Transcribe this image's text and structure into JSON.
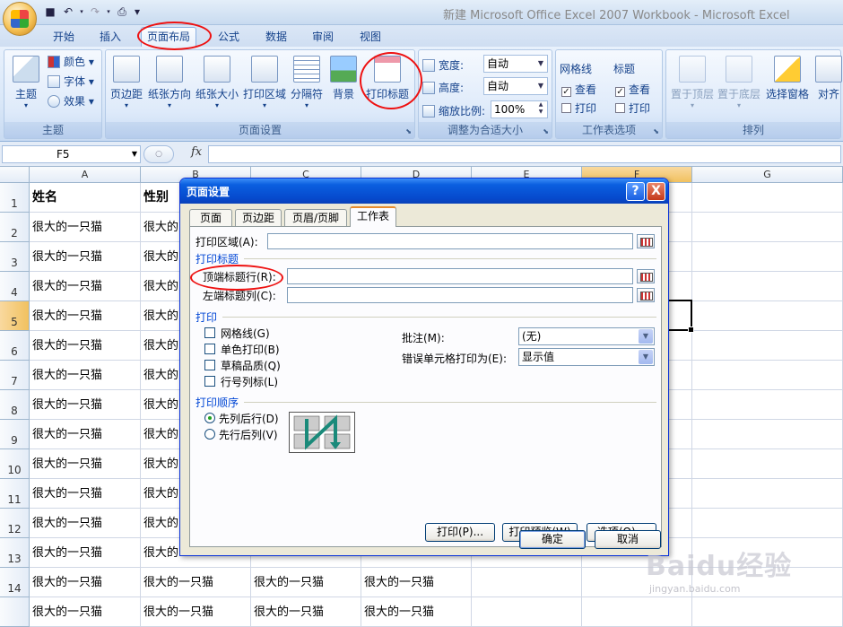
{
  "window": {
    "title": "新建 Microsoft Office Excel 2007 Workbook - Microsoft Excel"
  },
  "tabs": [
    "开始",
    "插入",
    "页面布局",
    "公式",
    "数据",
    "审阅",
    "视图"
  ],
  "active_tab": "页面布局",
  "ribbon": {
    "themes_group": {
      "title": "主题",
      "themes_button": "主题",
      "colors": "颜色",
      "fonts": "字体",
      "effects": "效果"
    },
    "page_setup_group": {
      "title": "页面设置",
      "buttons": [
        "页边距",
        "纸张方向",
        "纸张大小",
        "打印区域",
        "分隔符",
        "背景",
        "打印标题"
      ]
    },
    "scale_group": {
      "title": "调整为合适大小",
      "width_label": "宽度:",
      "width_value": "自动",
      "height_label": "高度:",
      "height_value": "自动",
      "scale_label": "缩放比例:",
      "scale_value": "100%"
    },
    "sheet_options_group": {
      "title": "工作表选项",
      "gridlines": "网格线",
      "headings": "标题",
      "view": "查看",
      "print": "打印"
    },
    "arrange_group": {
      "title": "排列",
      "buttons": [
        "置于顶层",
        "置于底层",
        "选择窗格",
        "对齐"
      ]
    }
  },
  "formula_bar": {
    "name_box": "F5",
    "fx": "fx",
    "content": ""
  },
  "sheet": {
    "columns": [
      "A",
      "B",
      "C",
      "D",
      "E",
      "F",
      "G"
    ],
    "selected_column": "F",
    "rows": [
      "1",
      "2",
      "3",
      "4",
      "5",
      "6",
      "7",
      "8",
      "9",
      "10",
      "11",
      "12",
      "13",
      "14",
      ""
    ],
    "selected_row": "5",
    "header_a": "姓名",
    "header_b": "性别",
    "cell_text": "很大的一只猫",
    "cell_b_partial": "很大的"
  },
  "dialog": {
    "title": "页面设置",
    "help": "?",
    "close": "X",
    "tabs": [
      "页面",
      "页边距",
      "页眉/页脚",
      "工作表"
    ],
    "active_tab": "工作表",
    "print_area_label": "打印区域(A):",
    "print_titles_section": "打印标题",
    "rows_to_repeat_label": "顶端标题行(R):",
    "cols_to_repeat_label": "左端标题列(C):",
    "print_section": "打印",
    "gridlines_label": "网格线(G)",
    "bw_label": "单色打印(B)",
    "draft_label": "草稿品质(Q)",
    "headings_label": "行号列标(L)",
    "comments_label": "批注(M):",
    "comments_value": "(无)",
    "errors_label": "错误单元格打印为(E):",
    "errors_value": "显示值",
    "page_order_section": "打印顺序",
    "down_then_over": "先列后行(D)",
    "over_then_down": "先行后列(V)",
    "print_button": "打印(P)...",
    "preview_button": "打印预览(W)",
    "options_button": "选项(O)...",
    "ok_button": "确定",
    "cancel_button": "取消"
  },
  "watermark": {
    "logo": "Baidu经验",
    "url": "jingyan.baidu.com"
  },
  "colors": {
    "accent_blue": "#15428b",
    "annotation_red": "#e11111",
    "selection_orange": "#f1c15f"
  }
}
